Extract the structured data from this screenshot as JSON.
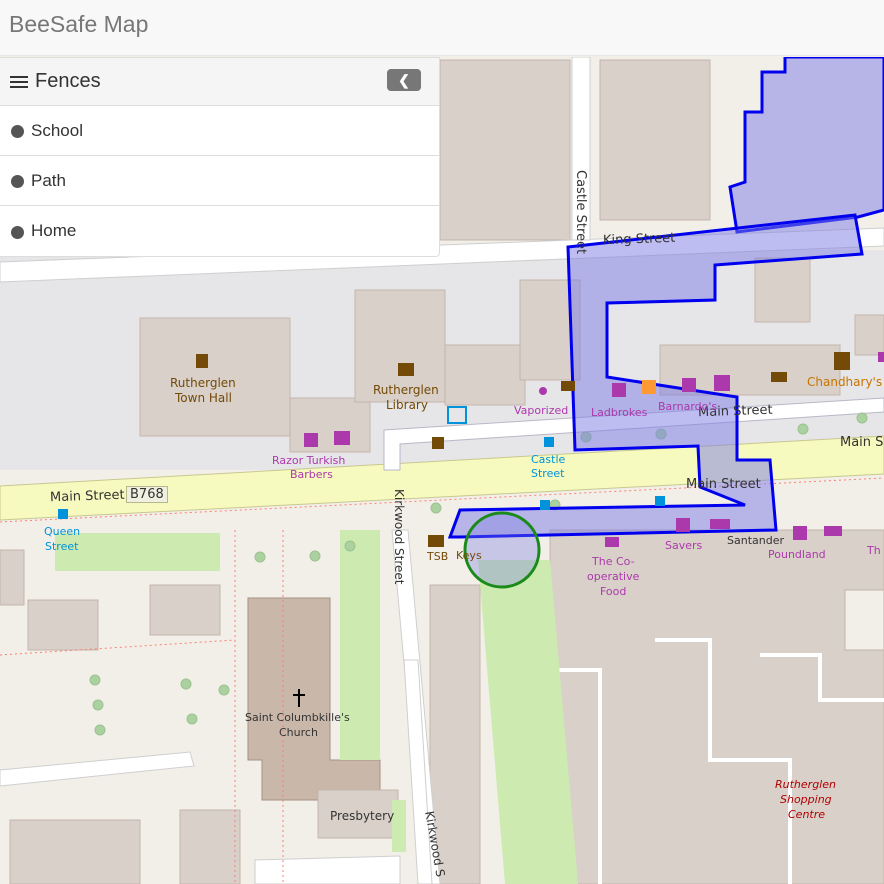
{
  "app": {
    "title": "BeeSafe Map"
  },
  "panel": {
    "title": "Fences",
    "collapse_icon": "chevron-left-icon",
    "items": [
      {
        "label": "School",
        "icon": "globe-icon"
      },
      {
        "label": "Path",
        "icon": "globe-icon"
      },
      {
        "label": "Home",
        "icon": "globe-icon"
      }
    ]
  },
  "map": {
    "labels": {
      "castle_street": "Castle Street",
      "king_street": "King Street",
      "main_street_west": "Main Street",
      "b768": "B768",
      "main_street_mid": "Main Street",
      "main_street_east": "Main St",
      "main_street_lower": "Main Street",
      "rutherglen_town_hall_1": "Rutherglen",
      "rutherglen_town_hall_2": "Town Hall",
      "rutherglen_library_1": "Rutherglen",
      "rutherglen_library_2": "Library",
      "vaporized": "Vaporized",
      "ladbrokes": "Ladbrokes",
      "barnardos": "Barnardo's",
      "chandharys": "Chandhary's",
      "razor_1": "Razor Turkish",
      "razor_2": "Barbers",
      "castle_stop_1": "Castle",
      "castle_stop_2": "Street",
      "queen_1": "Queen",
      "queen_2": "Street",
      "kirkwood_1": "Kirkwood Street",
      "kirkwood_2": "Kirkwood S",
      "tsb": "TSB",
      "keys": "Keys",
      "coop_1": "The Co-",
      "coop_2": "operative",
      "coop_3": "Food",
      "savers": "Savers",
      "santander": "Santander",
      "poundland": "Poundland",
      "th": "Th",
      "church_1": "Saint Columbkille's",
      "church_2": "Church",
      "presbytery": "Presbytery",
      "shopping_1": "Rutherglen",
      "shopping_2": "Shopping",
      "shopping_3": "Centre"
    },
    "colors": {
      "fence_stroke": "#0000ee",
      "fence_fill": "#7b7be6",
      "circle_stroke": "#1a8a1a",
      "road_main": "#f7fabf",
      "building": "#d9d0c9",
      "poi_purple": "#ac39ac",
      "poi_blue": "#0092da",
      "poi_brown": "#734a08"
    }
  }
}
